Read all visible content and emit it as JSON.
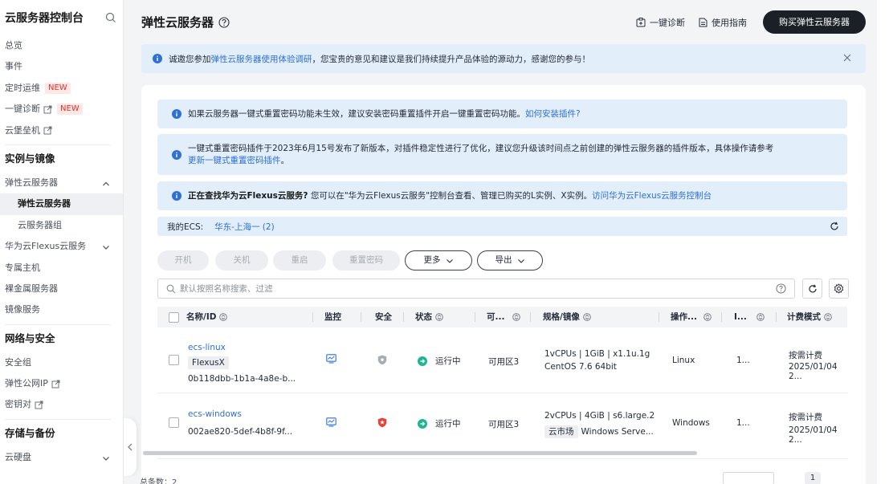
{
  "sidebar": {
    "title": "云服务器控制台",
    "items_top": [
      {
        "label": "总览"
      },
      {
        "label": "事件"
      },
      {
        "label": "定时运维",
        "badge": "NEW"
      },
      {
        "label": "一键诊断",
        "badge": "NEW",
        "external": true
      },
      {
        "label": "云堡垒机",
        "external": true
      }
    ],
    "group_instances": "实例与镜像",
    "ecs_parent": "弹性云服务器",
    "ecs_active": "弹性云服务器",
    "ecs_group": "云服务器组",
    "flexus": "华为云Flexus云服务",
    "dedicated_host": "专属主机",
    "bms": "裸金属服务器",
    "image_service": "镜像服务",
    "group_network": "网络与安全",
    "security_group": "安全组",
    "eip": "弹性公网IP",
    "keypair": "密钥对",
    "group_storage": "存储与备份",
    "cloud_disk": "云硬盘"
  },
  "topbar": {
    "page_title": "弹性云服务器",
    "diagnose": "一键诊断",
    "guide": "使用指南",
    "buy": "购买弹性云服务器"
  },
  "notice": {
    "pre": "诚邀您参加",
    "link": "弹性云服务器使用体验调研",
    "post": "，您宝贵的意见和建议是我们持续提升产品体验的源动力，感谢您的参与！"
  },
  "alerts": {
    "a1_text": "如果云服务器一键式重置密码功能未生效，建议安装密码重置插件开启一键重置密码功能。",
    "a1_link": "如何安装插件?",
    "a2_text": "一键式重置密码插件于2023年6月15号发布了新版本，对插件稳定性进行了优化，建议您升级该时间点之前创建的弹性云服务器的插件版本，具体操作请参考",
    "a2_link": "更新一键式重置密码插件",
    "a2_end": "。",
    "a3_bold": "正在查找华为云Flexus云服务?",
    "a3_text": " 您可以在\"华为云Flexus云服务\"控制台查看、管理已购买的L实例、X实例。",
    "a3_link": "访问华为云Flexus云服务控制台"
  },
  "region": {
    "label": "我的ECS:",
    "value": "华东-上海一 (2)"
  },
  "actions": {
    "start": "开机",
    "stop": "关机",
    "restart": "重启",
    "reset_pwd": "重置密码",
    "more": "更多",
    "export": "导出"
  },
  "search": {
    "placeholder": "默认按照名称搜索、过滤"
  },
  "table": {
    "headers": {
      "name": "名称/ID",
      "monitor": "监控",
      "security": "安全",
      "status": "状态",
      "az": "可...",
      "spec": "规格/镜像",
      "os": "操作...",
      "ip": "I...",
      "billing": "计费模式"
    },
    "rows": [
      {
        "name": "ecs-linux",
        "tag": "FlexusX",
        "id": "0b118dbb-1b1a-4a8e-b...",
        "status": "运行中",
        "az": "可用区3",
        "spec1": "1vCPUs | 1GiB | x1.1u.1g",
        "spec2": "CentOS 7.6 64bit",
        "os": "Linux",
        "ip": "1...",
        "billing1": "按需计费",
        "billing2": "2025/01/04 2..."
      },
      {
        "name": "ecs-windows",
        "id": "002ae820-5def-4b8f-9f...",
        "status": "运行中",
        "az": "可用区3",
        "spec1": "2vCPUs | 4GiB | s6.large.2",
        "spec_tag": "云市场",
        "spec2": "Windows Serve...",
        "os": "Windows",
        "ip": "1...",
        "billing1": "按需计费",
        "billing2": "2025/01/04 2..."
      }
    ]
  },
  "footer": {
    "total": "总条数：2",
    "current_page": "1"
  },
  "colors": {
    "accent": "#2e6fd8",
    "info_bg": "#e2eefa",
    "running": "#1fb58f",
    "danger": "#e8413b",
    "badge_new": "#e0322b"
  }
}
